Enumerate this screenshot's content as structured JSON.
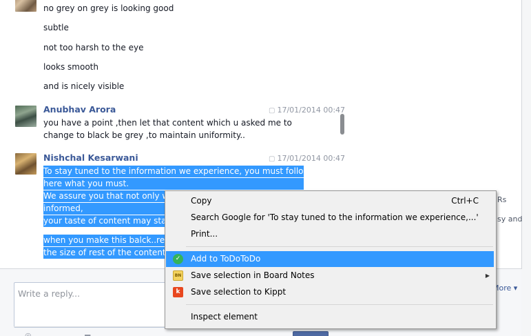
{
  "chat": {
    "earlier_messages": [
      "no grey on grey is looking good",
      "subtle",
      "not too harsh to the eye",
      "looks smooth",
      "and is nicely visible"
    ],
    "messages": [
      {
        "author": "Anubhav Arora",
        "timestamp": "17/01/2014 00:47",
        "lines": [
          "you have   a point ,then let that content which u asked me to",
          "change to black be grey ,to maintain uniformity.."
        ]
      },
      {
        "author": "Nishchal Kesarwani",
        "timestamp": "17/01/2014 00:47",
        "selected_lines": [
          "To stay tuned to the information we experience, you must follow",
          "here what you must.",
          "We assure you that not only wi",
          "informed,",
          "your taste of content may start",
          "when you make this balck..redu",
          "the size of rest of the content"
        ]
      }
    ]
  },
  "side_fragments": [
    "Rs",
    "sy and"
  ],
  "reply": {
    "placeholder": "Write a reply...",
    "more_label": "More ▾"
  },
  "context_menu": {
    "items": [
      {
        "label": "Copy",
        "shortcut": "Ctrl+C"
      },
      {
        "label": "Search Google for 'To stay tuned to the information we experience,...'"
      },
      {
        "label": "Print..."
      },
      {
        "label": "Add to ToDoToDo",
        "icon": "todotodo-icon",
        "highlighted": true
      },
      {
        "label": "Save selection in Board Notes",
        "icon": "board-notes-icon",
        "submenu": true
      },
      {
        "label": "Save selection to Kippt",
        "icon": "kippt-icon"
      },
      {
        "label": "Inspect element"
      }
    ],
    "icons": {
      "board_notes_text": "BN",
      "kippt_text": "k",
      "todotodo_text": "✓"
    },
    "colors": {
      "highlight": "#3399ff",
      "menu_bg": "#f0f0f0"
    }
  },
  "colors": {
    "link": "#3b5998",
    "selection": "#3399ff"
  }
}
